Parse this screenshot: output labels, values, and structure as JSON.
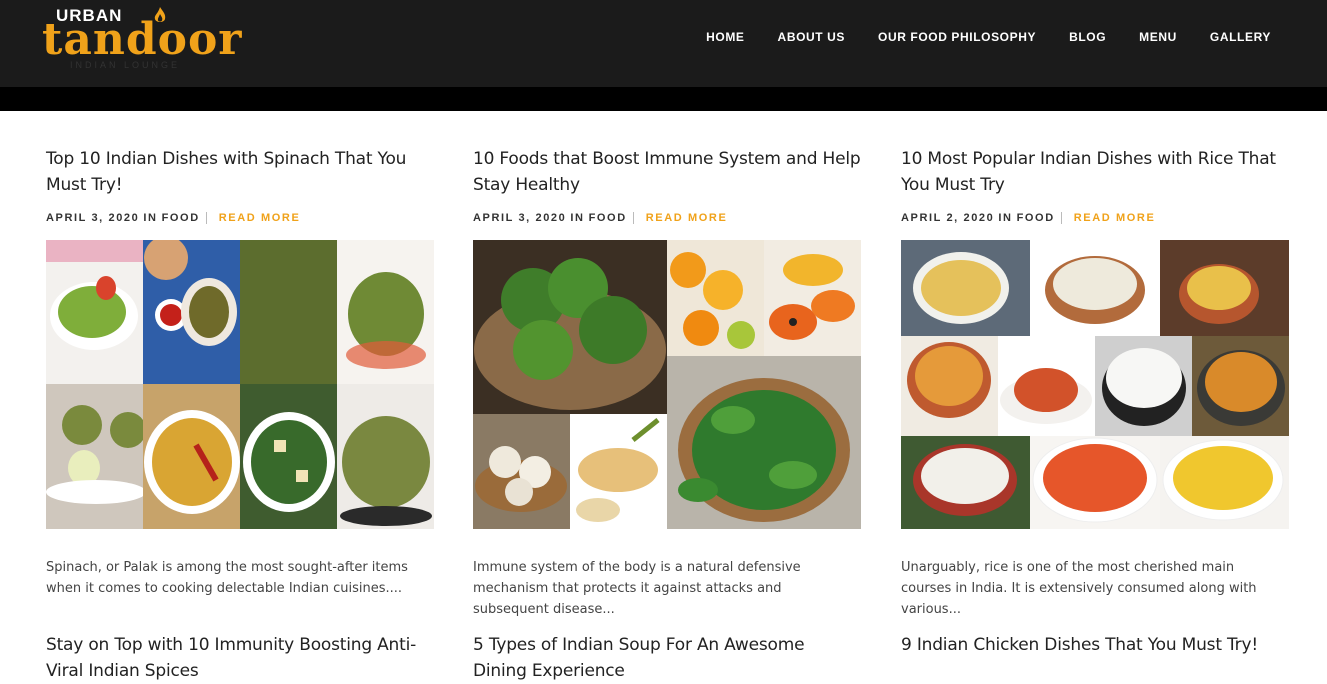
{
  "brand": {
    "urban": "URBAN",
    "tandoor": "tandoor",
    "tagline": "INDIAN LOUNGE"
  },
  "nav": [
    "HOME",
    "ABOUT US",
    "OUR FOOD PHILOSOPHY",
    "BLOG",
    "MENU",
    "GALLERY"
  ],
  "posts": [
    {
      "title": "Top 10 Indian Dishes with Spinach That You Must Try!",
      "date": "APRIL 3, 2020",
      "in": "IN",
      "category": "FOOD",
      "read_more": "READ MORE",
      "excerpt": "Spinach, or Palak is among the most sought-after items when it comes to cooking delectable Indian cuisines....",
      "image": "spinach-dishes-collage"
    },
    {
      "title": "10 Foods that Boost Immune System and Help Stay Healthy",
      "date": "APRIL 3, 2020",
      "in": "IN",
      "category": "FOOD",
      "read_more": "READ MORE",
      "excerpt": "Immune system of the body is a natural defensive mechanism that protects it against attacks and subsequent disease...",
      "image": "immune-foods-collage"
    },
    {
      "title": "10 Most Popular Indian Dishes with Rice That You Must Try",
      "date": "APRIL 2, 2020",
      "in": "IN",
      "category": "FOOD",
      "read_more": "READ MORE",
      "excerpt": "Unarguably, rice is one of the most cherished main courses in India. It is extensively consumed along with various...",
      "image": "rice-dishes-collage"
    },
    {
      "title": "Stay on Top with 10 Immunity Boosting Anti-Viral Indian Spices"
    },
    {
      "title": "5 Types of Indian Soup For An Awesome Dining Experience"
    },
    {
      "title": "9 Indian Chicken Dishes That You Must Try!"
    }
  ],
  "colors": {
    "header": "#1b1b1b",
    "accent": "#f0a21a"
  }
}
